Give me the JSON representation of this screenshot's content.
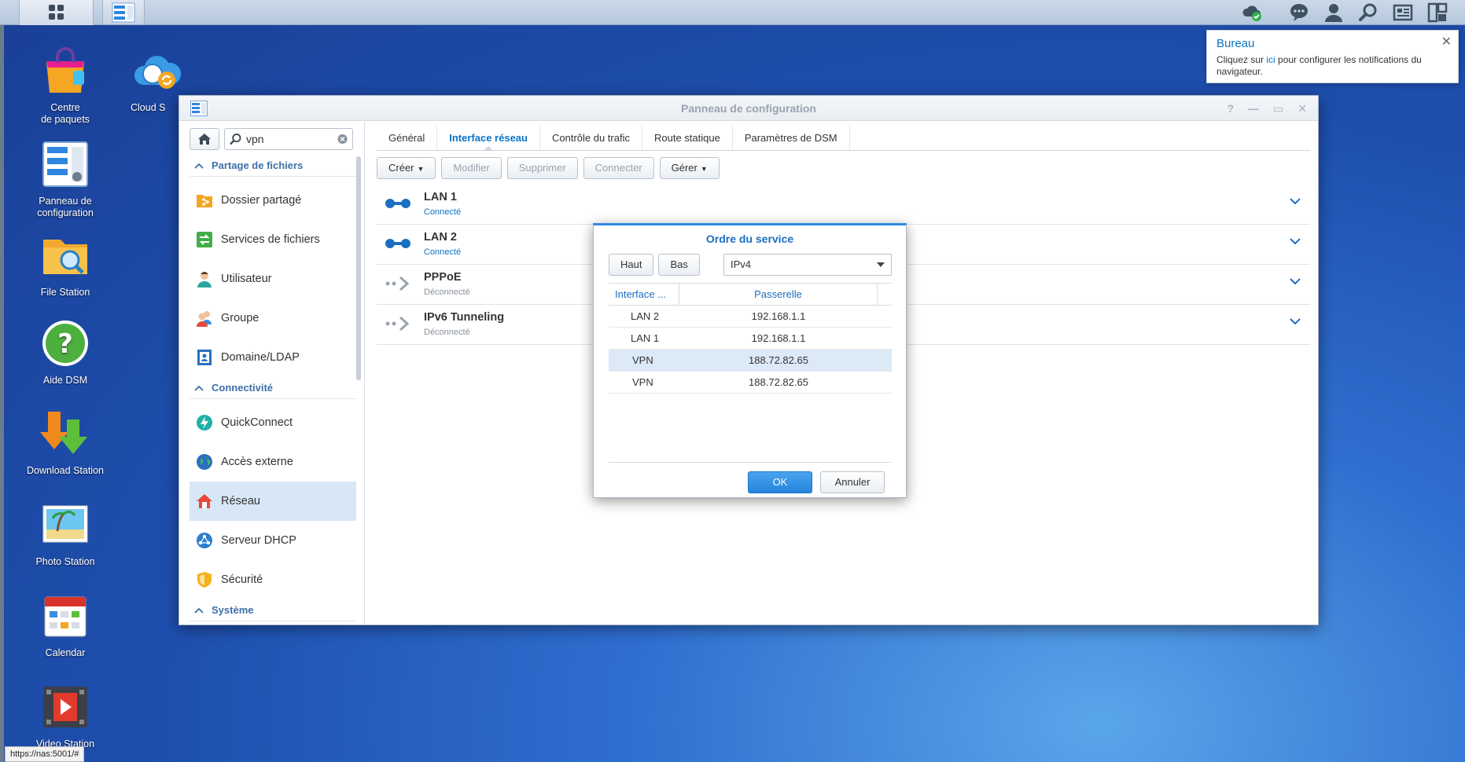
{
  "taskbar": {
    "main_menu_icon": "grid-menu-icon",
    "open_app_icon": "control-panel-icon",
    "right_icons": [
      "cloud-check-icon",
      "chat-icon",
      "user-icon",
      "search-icon",
      "widgets-icon",
      "layout-icon"
    ]
  },
  "notification": {
    "title": "Bureau",
    "text_before": "Cliquez sur ",
    "link": "ici",
    "text_after": " pour configurer les notifications du navigateur.",
    "close": "✕"
  },
  "desktop": {
    "icons": [
      {
        "label_line1": "Centre",
        "label_line2": "de paquets"
      },
      {
        "label_line1": "Panneau de",
        "label_line2": "configuration"
      },
      {
        "label_line1": "File Station",
        "label_line2": ""
      },
      {
        "label_line1": "Aide DSM",
        "label_line2": ""
      },
      {
        "label_line1": "Download Station",
        "label_line2": ""
      },
      {
        "label_line1": "Photo Station",
        "label_line2": ""
      },
      {
        "label_line1": "Calendar",
        "label_line2": ""
      },
      {
        "label_line1": "Video Station",
        "label_line2": ""
      },
      {
        "label_line1": "Cloud S",
        "label_line2": ""
      }
    ]
  },
  "window": {
    "title": "Panneau de configuration",
    "controls": [
      "?",
      "—",
      "▭",
      "✕"
    ]
  },
  "sidebar": {
    "search_value": "vpn",
    "sections": [
      {
        "title": "Partage de fichiers",
        "items": [
          "Dossier partagé",
          "Services de fichiers",
          "Utilisateur",
          "Groupe",
          "Domaine/LDAP"
        ]
      },
      {
        "title": "Connectivité",
        "items": [
          "QuickConnect",
          "Accès externe",
          "Réseau",
          "Serveur DHCP",
          "Sécurité"
        ]
      },
      {
        "title": "Système",
        "items": []
      }
    ],
    "active_item": "Réseau"
  },
  "tabs": [
    "Général",
    "Interface réseau",
    "Contrôle du trafic",
    "Route statique",
    "Paramètres de DSM"
  ],
  "active_tab": "Interface réseau",
  "toolbar": {
    "create": "Créer",
    "modify": "Modifier",
    "delete": "Supprimer",
    "connect": "Connecter",
    "manage": "Gérer"
  },
  "interfaces": [
    {
      "name": "LAN 1",
      "status": "Connecté",
      "connected": true
    },
    {
      "name": "LAN 2",
      "status": "Connecté",
      "connected": true
    },
    {
      "name": "PPPoE",
      "status": "Déconnecté",
      "connected": false
    },
    {
      "name": "IPv6 Tunneling",
      "status": "Déconnecté",
      "connected": false
    }
  ],
  "dialog": {
    "title": "Ordre du service",
    "up": "Haut",
    "down": "Bas",
    "protocol": "IPv4",
    "col_interface": "Interface ...",
    "col_gateway": "Passerelle",
    "rows": [
      {
        "interface": "LAN 2",
        "gateway": "192.168.1.1"
      },
      {
        "interface": "LAN 1",
        "gateway": "192.168.1.1"
      },
      {
        "interface": "VPN",
        "gateway": "188.72.82.65"
      },
      {
        "interface": "VPN",
        "gateway": "188.72.82.65"
      }
    ],
    "ok": "OK",
    "cancel": "Annuler"
  },
  "statusbar": "https://nas:5001/#",
  "colors": {
    "accent": "#0b74c7",
    "desktop": "#1e4fae",
    "selection": "#d8e7f7"
  }
}
